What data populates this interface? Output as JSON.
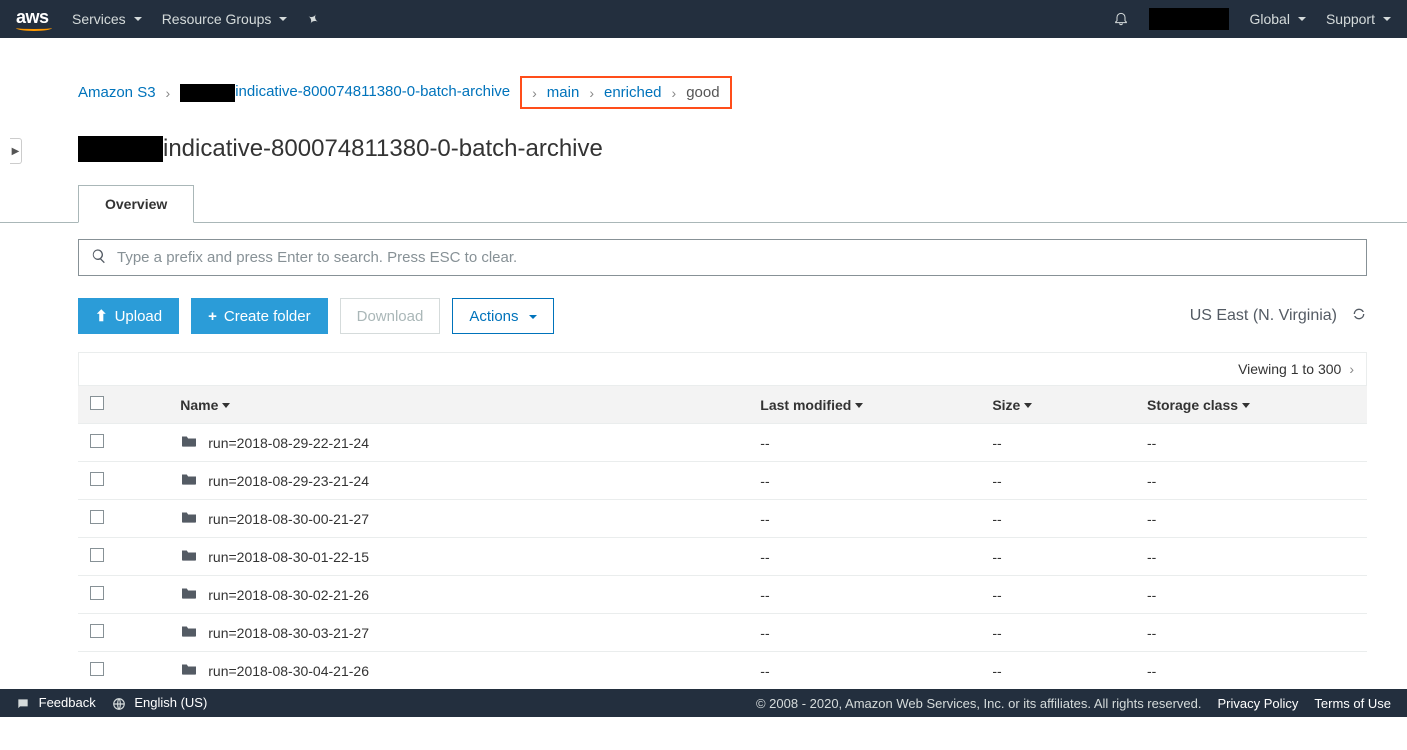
{
  "nav": {
    "logo": "aws",
    "services": "Services",
    "resource_groups": "Resource Groups",
    "global": "Global",
    "support": "Support"
  },
  "breadcrumb": {
    "root": "Amazon S3",
    "bucket_suffix": "indicative-800074811380-0-batch-archive",
    "p1": "main",
    "p2": "enriched",
    "p3": "good"
  },
  "page_title_suffix": "indicative-800074811380-0-batch-archive",
  "tabs": {
    "overview": "Overview"
  },
  "search": {
    "placeholder": "Type a prefix and press Enter to search. Press ESC to clear."
  },
  "toolbar": {
    "upload": "Upload",
    "create_folder": "Create folder",
    "download": "Download",
    "actions": "Actions",
    "region": "US East (N. Virginia)"
  },
  "pager": {
    "text": "Viewing 1 to 300"
  },
  "columns": {
    "name": "Name",
    "last_modified": "Last modified",
    "size": "Size",
    "storage_class": "Storage class"
  },
  "rows": [
    {
      "name": "run=2018-08-29-22-21-24",
      "last_modified": "--",
      "size": "--",
      "storage_class": "--"
    },
    {
      "name": "run=2018-08-29-23-21-24",
      "last_modified": "--",
      "size": "--",
      "storage_class": "--"
    },
    {
      "name": "run=2018-08-30-00-21-27",
      "last_modified": "--",
      "size": "--",
      "storage_class": "--"
    },
    {
      "name": "run=2018-08-30-01-22-15",
      "last_modified": "--",
      "size": "--",
      "storage_class": "--"
    },
    {
      "name": "run=2018-08-30-02-21-26",
      "last_modified": "--",
      "size": "--",
      "storage_class": "--"
    },
    {
      "name": "run=2018-08-30-03-21-27",
      "last_modified": "--",
      "size": "--",
      "storage_class": "--"
    },
    {
      "name": "run=2018-08-30-04-21-26",
      "last_modified": "--",
      "size": "--",
      "storage_class": "--"
    }
  ],
  "footer": {
    "feedback": "Feedback",
    "language": "English (US)",
    "copyright": "© 2008 - 2020, Amazon Web Services, Inc. or its affiliates. All rights reserved.",
    "privacy": "Privacy Policy",
    "terms": "Terms of Use"
  }
}
